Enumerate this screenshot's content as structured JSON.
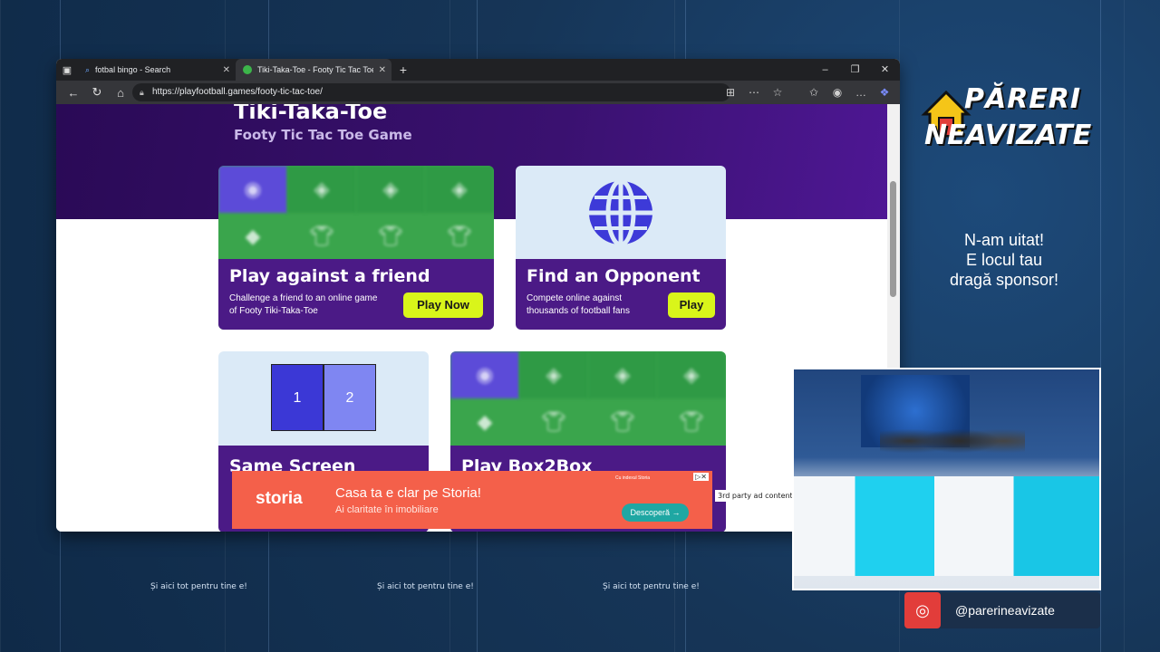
{
  "browser": {
    "tabs": [
      {
        "label": "fotbal bingo - Search",
        "icon": "search-icon"
      },
      {
        "label": "Tiki-Taka-Toe - Footy Tic Tac Toe G",
        "icon": "favicon-ball"
      }
    ],
    "url": "https://playfootball.games/footy-tic-tac-toe/"
  },
  "page": {
    "title": "Tiki-Taka-Toe",
    "subtitle": "Footy Tic Tac Toe Game",
    "cards": {
      "friend": {
        "title": "Play against a friend",
        "desc1": "Challenge a friend to an online game",
        "desc2": "of Footy Tiki-Taka-Toe",
        "button": "Play Now"
      },
      "opponent": {
        "title": "Find an Opponent",
        "desc1": "Compete online against",
        "desc2": "thousands of football fans",
        "button": "Play"
      },
      "same_screen": {
        "title": "Same Screen",
        "left": "1",
        "right": "2"
      },
      "box2box": {
        "title": "Play Box2Box"
      }
    }
  },
  "ad": {
    "brand": "storia",
    "headline": "Casa ta e clar pe Storia!",
    "sub": "Ai claritate în imobiliare",
    "button": "Descoperă →",
    "small": "Cu indexul Storia",
    "label": "3rd party ad content"
  },
  "overlay": {
    "brand_line1": "PĂRERI",
    "brand_line2": "NEAVIZATE",
    "sponsor_lines": [
      "N-am uitat!",
      "E locul tau",
      "dragă sponsor!"
    ],
    "footer": [
      "Și aici tot pentru tine e!",
      "Și aici tot pentru tine e!",
      "Și aici tot pentru tine e!"
    ],
    "instagram": "@parerineavizate"
  },
  "colors": {
    "accent": "#d9f51a",
    "hero": "#3a1170",
    "card_bottom": "#4b1a86",
    "ad": "#f4604a",
    "globe": "#3d3ad8"
  }
}
